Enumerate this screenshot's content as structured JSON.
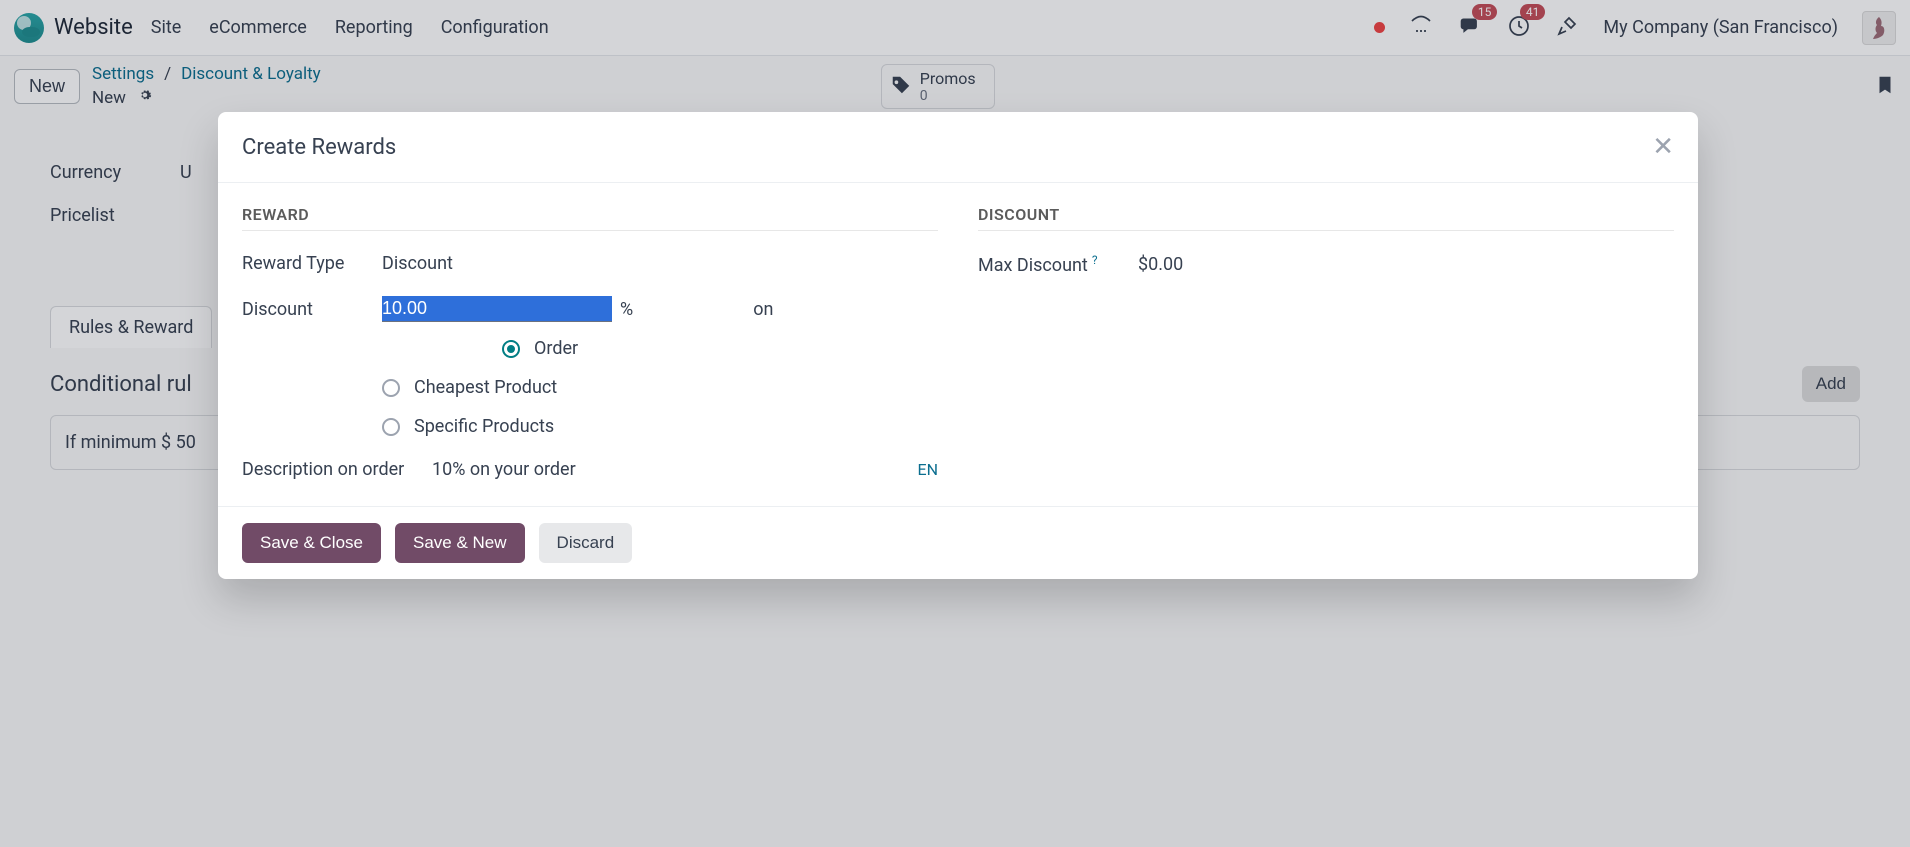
{
  "menubar": {
    "brand": "Website",
    "items": [
      "Site",
      "eCommerce",
      "Reporting",
      "Configuration"
    ],
    "company": "My Company (San Francisco)",
    "msg_badge": "15",
    "acts_badge": "41"
  },
  "control": {
    "new_btn": "New",
    "crumb_settings": "Settings",
    "crumb_discount": "Discount & Loyalty",
    "crumb_new": "New",
    "promos_label": "Promos",
    "promos_count": "0"
  },
  "bg": {
    "currency_label": "Currency",
    "currency_value": "U",
    "pricelist_label": "Pricelist",
    "tab": "Rules & Reward",
    "cond_title": "Conditional rul",
    "add_btn": "Add",
    "rule_text": "If minimum $ 50"
  },
  "modal": {
    "title": "Create Rewards",
    "reward_header": "REWARD",
    "discount_header": "DISCOUNT",
    "reward_type_label": "Reward Type",
    "reward_type_value": "Discount",
    "discount_label": "Discount",
    "discount_value": "10.00",
    "discount_unit": "%",
    "discount_on": "on",
    "radios": {
      "order": "Order",
      "cheapest": "Cheapest Product",
      "specific": "Specific Products",
      "selected": "order"
    },
    "description_label": "Description on order",
    "description_value": "10% on your order",
    "lang": "EN",
    "max_label": "Max Discount",
    "max_value": "$0.00",
    "save_close": "Save & Close",
    "save_new": "Save & New",
    "discard": "Discard"
  }
}
